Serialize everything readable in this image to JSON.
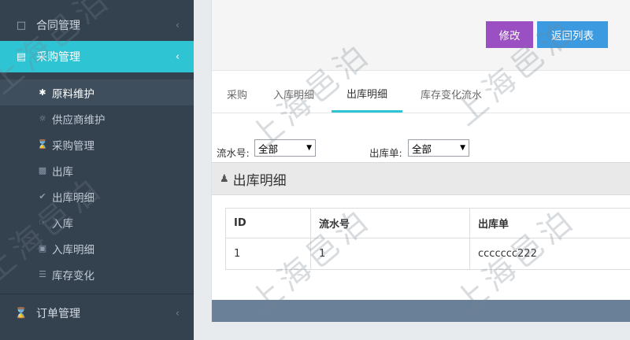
{
  "sidebar": {
    "menus": [
      {
        "label": "合同管理",
        "icon": "document-icon"
      },
      {
        "label": "采购管理",
        "icon": "window-icon"
      },
      {
        "label": "订单管理",
        "icon": "cart-icon"
      }
    ],
    "submenu": [
      {
        "label": "原料维护",
        "icon": "asterisk-icon"
      },
      {
        "label": "供应商维护",
        "icon": "binoculars-icon"
      },
      {
        "label": "采购管理",
        "icon": "cart-icon"
      },
      {
        "label": "出库",
        "icon": "truck-icon"
      },
      {
        "label": "出库明细",
        "icon": "check-circle-icon"
      },
      {
        "label": "入库",
        "icon": "hand-icon"
      },
      {
        "label": "入库明细",
        "icon": "devices-icon"
      },
      {
        "label": "库存变化",
        "icon": "database-icon"
      }
    ]
  },
  "toolbar": {
    "edit_label": "修改",
    "back_label": "返回列表",
    "edit_color": "#9a4fc2",
    "back_color": "#3c9be0"
  },
  "tabs": [
    {
      "label": "采购"
    },
    {
      "label": "入库明细"
    },
    {
      "label": "出库明细"
    },
    {
      "label": "库存变化流水"
    }
  ],
  "filters": {
    "serial_label": "流水号:",
    "serial_value": "全部",
    "outbound_label": "出库单:",
    "outbound_value": "全部"
  },
  "section": {
    "title": "出库明细",
    "icon": "user-icon"
  },
  "table": {
    "headers": [
      "ID",
      "流水号",
      "出库单"
    ],
    "rows": [
      [
        "1",
        "1",
        "ccccccc222"
      ]
    ]
  },
  "watermark": "上海邑泊",
  "accent_color": "#2fc4d4"
}
